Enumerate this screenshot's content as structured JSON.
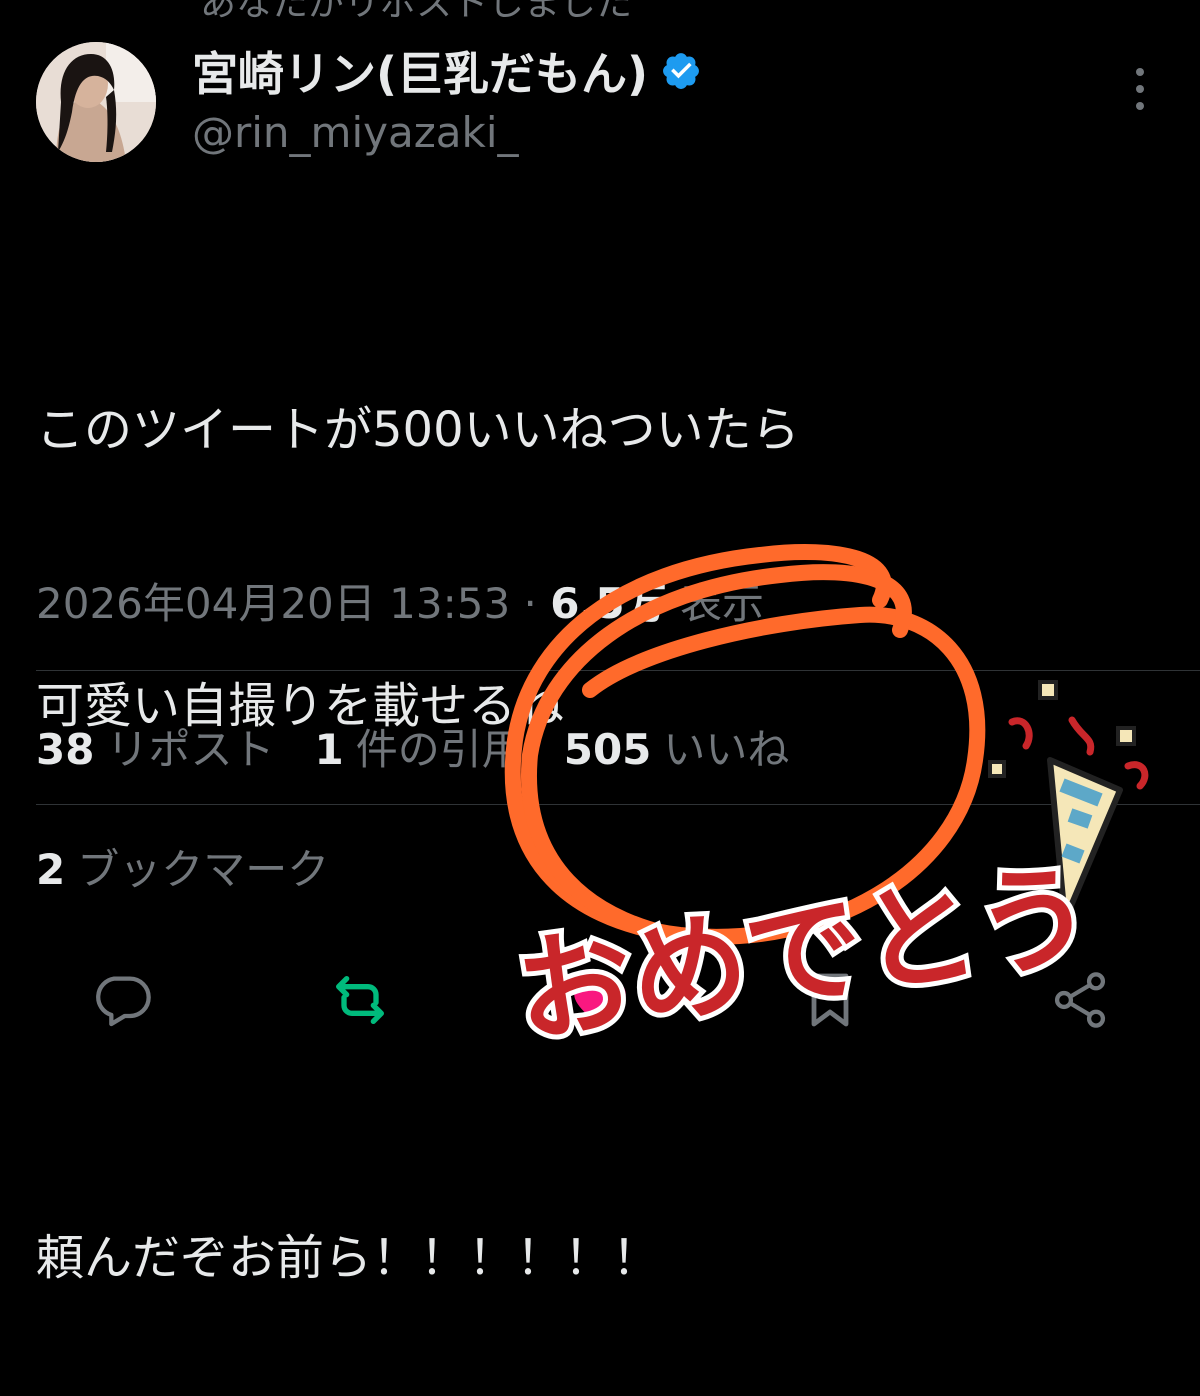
{
  "repost_banner": "あなたがリポストしました",
  "author": {
    "display_name": "宮崎リン(巨乳だもん)",
    "handle": "@rin_miyazaki_",
    "verified": true,
    "verified_color": "#1d9bf0"
  },
  "tweet": {
    "lines": [
      "このツイートが500いいねついたら",
      "可愛い自撮りを載せるね",
      "",
      "頼んだぞお前ら！！！！！！"
    ],
    "timestamp": "2026年04月20日 13:53",
    "separator": "·",
    "views_count": "6.5万",
    "views_label": "表示"
  },
  "stats": {
    "reposts_count": "38",
    "reposts_label": "リポスト",
    "quotes_count": "1",
    "quotes_label": "件の引用",
    "likes_count": "505",
    "likes_label": "いいね",
    "bookmarks_count": "2",
    "bookmarks_label": "ブックマーク"
  },
  "actions": {
    "reply_icon": "speech-bubble-icon",
    "repost_icon": "repost-arrows-icon",
    "like_icon": "heart-icon",
    "bookmark_icon": "bookmark-icon",
    "share_icon": "share-icon",
    "repost_active_color": "#00ba7c",
    "like_active_color": "#f91880"
  },
  "sticker": {
    "text": "おめでとう",
    "color": "#c9262a",
    "circle_color": "#ff6a2b"
  },
  "colors": {
    "background": "#000000",
    "text_primary": "#e7e9ea",
    "text_secondary": "#71767b",
    "divider": "#2f3336"
  }
}
